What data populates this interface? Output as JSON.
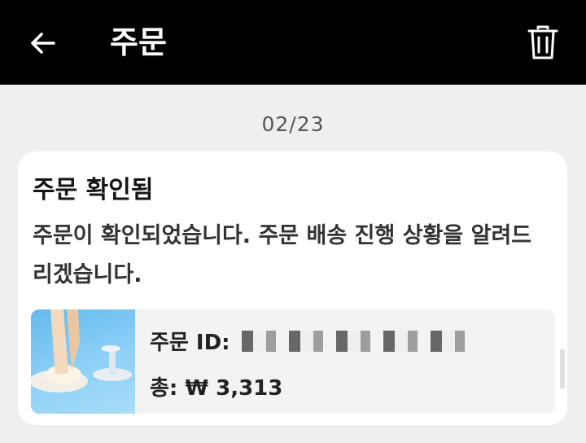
{
  "header": {
    "title": "주문",
    "back_icon": "arrow-left-icon",
    "delete_icon": "trash-icon"
  },
  "date": "02/23",
  "notification": {
    "title": "주문 확인됨",
    "message": "주문이 확인되었습니다. 주문 배송 진행 상황을 알려드리겠습니다.",
    "order": {
      "id_label": "주문 ID:",
      "total_label": "총:",
      "total_value": "₩ 3,313"
    }
  },
  "colors": {
    "header_bg": "#000000",
    "page_bg": "#efefef",
    "card_bg": "#ffffff"
  }
}
